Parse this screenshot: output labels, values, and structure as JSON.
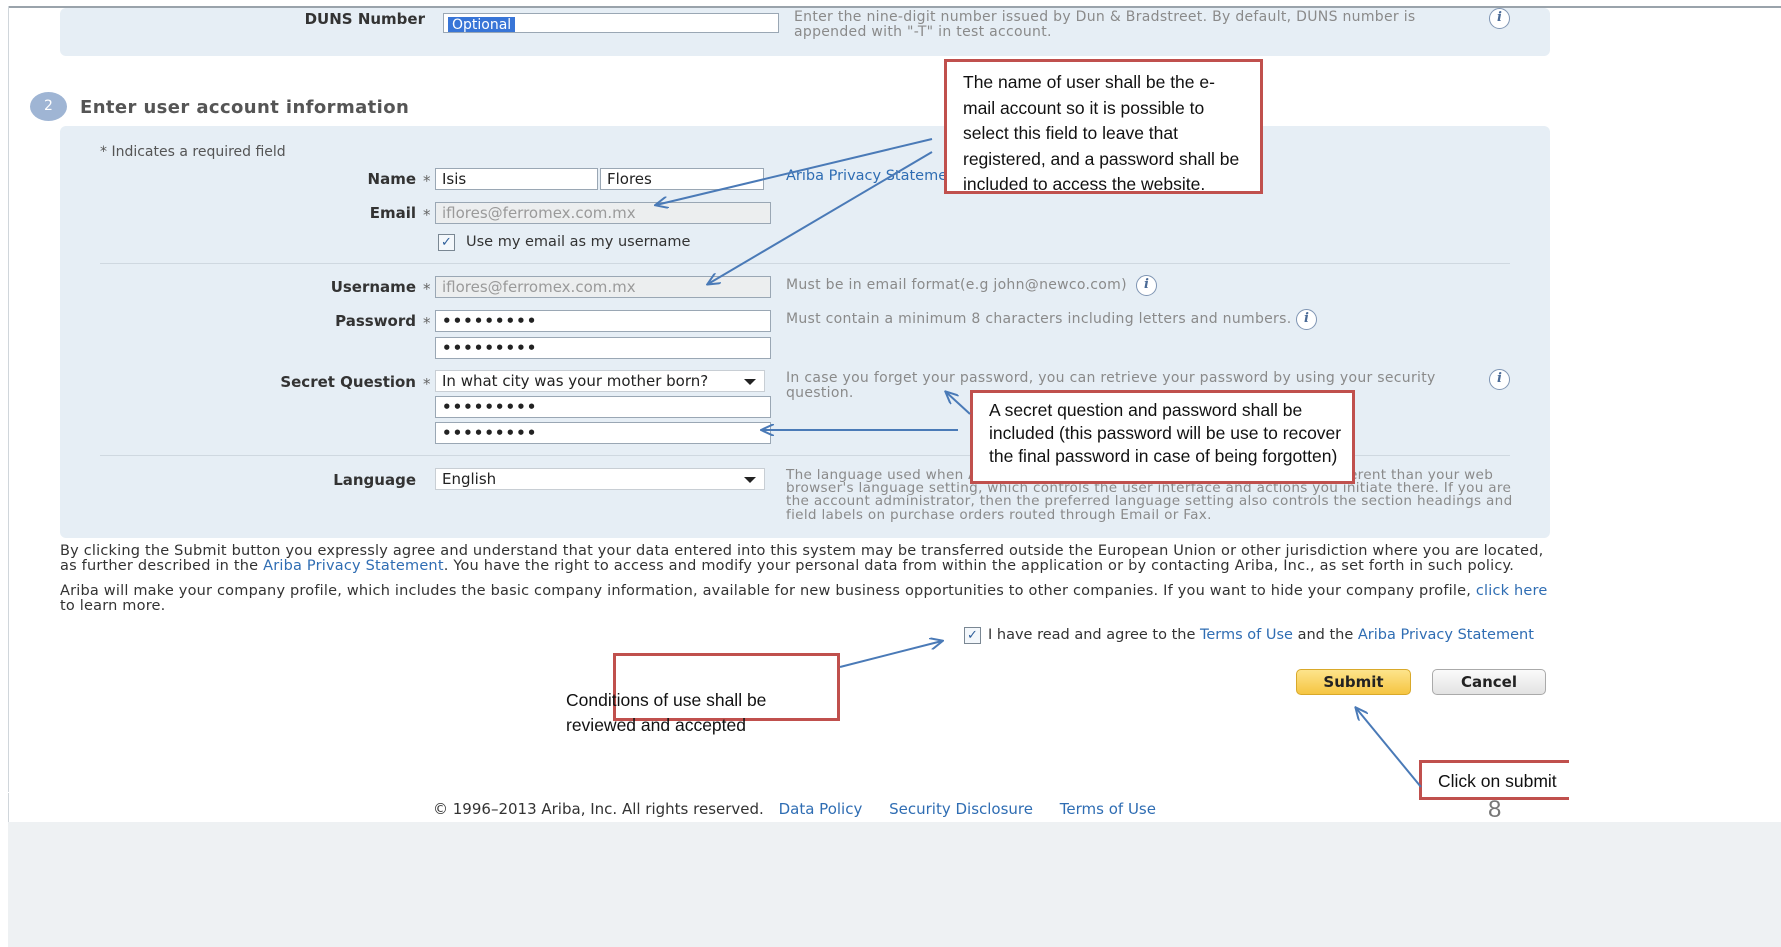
{
  "duns": {
    "label": "DUNS Number",
    "value": "Optional",
    "hint": "Enter the nine-digit number issued by Dun & Bradstreet. By default, DUNS number is appended with \"-T\" in test account."
  },
  "section2": {
    "number": "2",
    "title": "Enter user account information",
    "required_note": "* Indicates a required field"
  },
  "name": {
    "label": "Name",
    "required": "*",
    "first": "Isis",
    "last": "Flores",
    "privacy_link": "Ariba Privacy Statement"
  },
  "email": {
    "label": "Email",
    "required": "*",
    "value": "iflores@ferromex.com.mx",
    "use_as_username": "Use my email as my username"
  },
  "username": {
    "label": "Username",
    "required": "*",
    "value": "iflores@ferromex.com.mx",
    "hint": "Must be in email format(e.g john@newco.com)"
  },
  "password": {
    "label": "Password",
    "required": "*",
    "value": "•••••••••",
    "confirm": "•••••••••",
    "hint": "Must contain a minimum 8 characters including letters and numbers."
  },
  "secret": {
    "label": "Secret Question",
    "required": "*",
    "question": "In what city was your mother born?",
    "answer": "•••••••••",
    "confirm": "•••••••••",
    "hint": "In case you forget your password, you can retrieve your password by using your security question."
  },
  "language": {
    "label": "Language",
    "value": "English",
    "hint": "The language used when Ariba sends you configurable notifications. This is different than your web browser's language setting, which controls the user interface and actions you initiate there. If you are the account administrator, then the preferred language setting also controls the section headings and field labels on purchase orders routed through Email or Fax."
  },
  "consent": {
    "p1_before": "By clicking the Submit button you expressly agree and understand that your data entered into this system may be transferred outside the European Union or other jurisdiction where you are located, as further described in the ",
    "p1_link": "Ariba Privacy Statement",
    "p1_after": ". You have the right to access and modify your personal data from within the application or by contacting Ariba, Inc., as set forth in such policy.",
    "p2_before": "Ariba will make your company profile, which includes the basic company information, available for new business opportunities to other companies. If you want to hide your company profile, ",
    "p2_link": "click here",
    "p2_after": " to learn more.",
    "agree_prefix": "I have read and agree to the ",
    "terms_link": "Terms of Use",
    "agree_mid": " and the ",
    "privacy_link": "Ariba Privacy Statement"
  },
  "buttons": {
    "submit": "Submit",
    "cancel": "Cancel"
  },
  "footer": {
    "copyright": "© 1996–2013 Ariba, Inc. All rights reserved.",
    "data_policy": "Data Policy",
    "security": "Security Disclosure",
    "terms": "Terms of Use",
    "page_number": "8"
  },
  "annotations": {
    "username_note": "The name of user shall be the e-mail account so it is possible to select this field to leave that registered, and a password shall be included to access the website.",
    "secret_note": "A secret question and password shall be included (this password will be use to recover the final password in case of being forgotten)",
    "conditions_note": "Conditions of use shall be reviewed and accepted",
    "submit_note": "Click on submit"
  },
  "colors": {
    "accent_link": "#2f6db3",
    "panel": "#e6eef5",
    "annotation_border": "#c0504d",
    "submit_button": "#f7cf52",
    "arrow": "#4a7ab7"
  }
}
